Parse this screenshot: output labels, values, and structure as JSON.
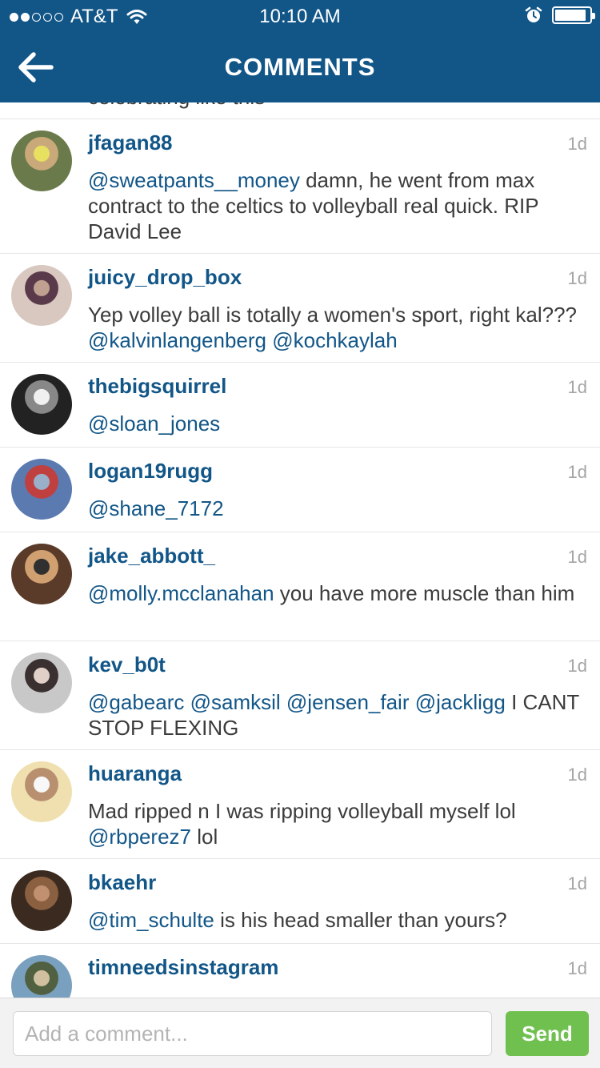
{
  "status_bar": {
    "signal_strength": 2,
    "signal_total": 5,
    "carrier": "AT&T",
    "time": "10:10 AM",
    "battery_level": 0.9
  },
  "nav": {
    "title": "COMMENTS",
    "back_icon": "arrow-left-icon"
  },
  "partial_comment": "celebrating like this",
  "comments": [
    {
      "username": "jfagan88",
      "time": "1d",
      "text": [
        {
          "t": "@sweatpants__money",
          "m": true
        },
        {
          "t": " damn, he went from max contract to the celtics to volleyball real quick. RIP David Lee",
          "m": false
        }
      ]
    },
    {
      "username": "juicy_drop_box",
      "time": "1d",
      "text": [
        {
          "t": "Yep volley ball is totally a women's sport, right kal??? ",
          "m": false
        },
        {
          "t": "@kalvinlangenberg",
          "m": true
        },
        {
          "t": " ",
          "m": false
        },
        {
          "t": "@kochkaylah",
          "m": true
        }
      ]
    },
    {
      "username": "thebigsquirrel",
      "time": "1d",
      "text": [
        {
          "t": "@sloan_jones",
          "m": true
        }
      ]
    },
    {
      "username": "logan19rugg",
      "time": "1d",
      "text": [
        {
          "t": "@shane_7172",
          "m": true
        }
      ]
    },
    {
      "username": "jake_abbott_",
      "time": "1d",
      "text": [
        {
          "t": "@molly.mcclanahan",
          "m": true
        },
        {
          "t": " you have more muscle than him",
          "m": false
        }
      ]
    },
    {
      "username": "kev_b0t",
      "time": "1d",
      "text": [
        {
          "t": "@gabearc",
          "m": true
        },
        {
          "t": " ",
          "m": false
        },
        {
          "t": "@samksil",
          "m": true
        },
        {
          "t": " ",
          "m": false
        },
        {
          "t": "@jensen_fair",
          "m": true
        },
        {
          "t": " ",
          "m": false
        },
        {
          "t": "@jackligg",
          "m": true
        },
        {
          "t": " I CANT STOP FLEXING",
          "m": false
        }
      ]
    },
    {
      "username": "huaranga",
      "time": "1d",
      "text": [
        {
          "t": "Mad ripped n I was ripping volleyball myself lol ",
          "m": false
        },
        {
          "t": "@rbperez7",
          "m": true
        },
        {
          "t": "  lol",
          "m": false
        }
      ]
    },
    {
      "username": "bkaehr",
      "time": "1d",
      "text": [
        {
          "t": "@tim_schulte",
          "m": true
        },
        {
          "t": " is his head smaller than yours?",
          "m": false
        }
      ]
    },
    {
      "username": "timneedsinstagram",
      "time": "1d",
      "text": []
    }
  ],
  "composer": {
    "placeholder": "Add a comment...",
    "send_label": "Send"
  },
  "colors": {
    "header": "#125688",
    "username": "#125688",
    "mention": "#125688",
    "body_text": "#3b3b3b",
    "timestamp": "#a5a5a5",
    "send_button": "#70c050"
  }
}
